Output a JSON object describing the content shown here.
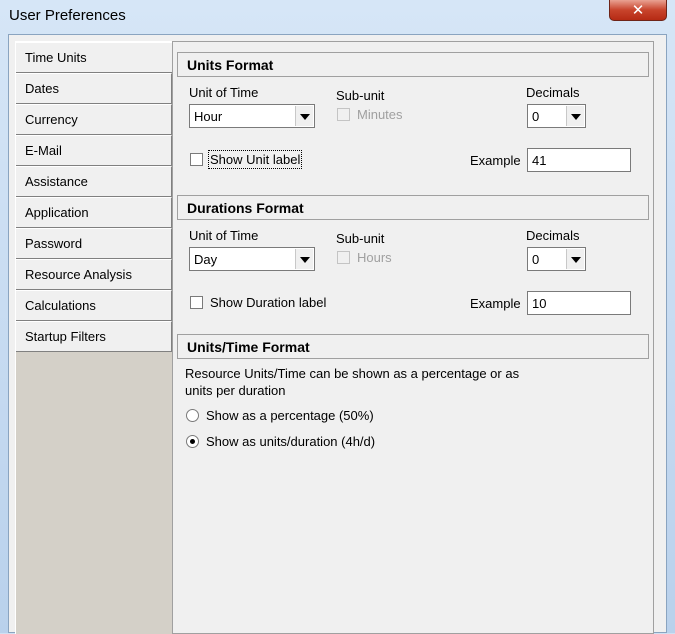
{
  "window": {
    "title": "User Preferences",
    "close_glyph": "✕"
  },
  "sidebar": {
    "items": [
      {
        "label": "Time Units",
        "active": true
      },
      {
        "label": "Dates"
      },
      {
        "label": "Currency"
      },
      {
        "label": "E-Mail"
      },
      {
        "label": "Assistance"
      },
      {
        "label": "Application"
      },
      {
        "label": "Password"
      },
      {
        "label": "Resource Analysis"
      },
      {
        "label": "Calculations"
      },
      {
        "label": "Startup Filters"
      }
    ]
  },
  "units_format": {
    "heading": "Units Format",
    "unit_of_time_label": "Unit of Time",
    "unit_of_time_value": "Hour",
    "subunit_label": "Sub-unit",
    "subunit_option": "Minutes",
    "decimals_label": "Decimals",
    "decimals_value": "0",
    "show_label": "Show Unit label",
    "example_label": "Example",
    "example_value": "41"
  },
  "durations_format": {
    "heading": "Durations Format",
    "unit_of_time_label": "Unit of Time",
    "unit_of_time_value": "Day",
    "subunit_label": "Sub-unit",
    "subunit_option": "Hours",
    "decimals_label": "Decimals",
    "decimals_value": "0",
    "show_label": "Show Duration label",
    "example_label": "Example",
    "example_value": "10"
  },
  "units_time_format": {
    "heading": "Units/Time Format",
    "description_line1": "Resource Units/Time can be shown as a percentage or as",
    "description_line2": "units per duration",
    "option_percentage": "Show as a percentage (50%)",
    "option_units_duration": "Show as units/duration (4h/d)",
    "selected": "units_duration"
  }
}
